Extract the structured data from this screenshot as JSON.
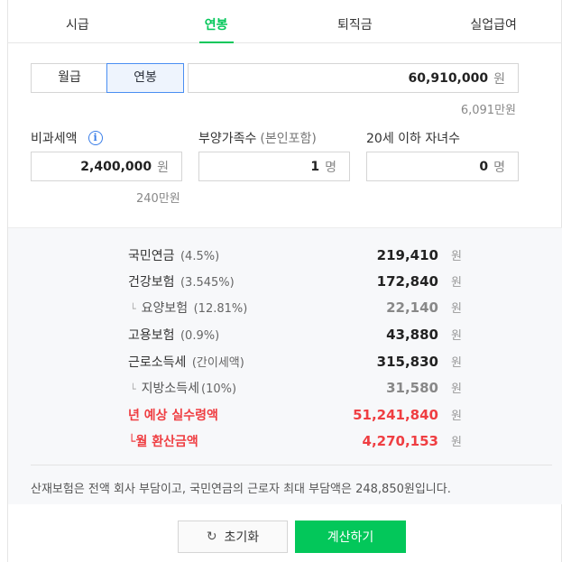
{
  "tabs": [
    {
      "label": "시급",
      "active": false
    },
    {
      "label": "연봉",
      "active": true
    },
    {
      "label": "퇴직금",
      "active": false
    },
    {
      "label": "실업급여",
      "active": false
    }
  ],
  "pay_type": {
    "monthly": "월급",
    "annual": "연봉",
    "selected": "연봉"
  },
  "salary": {
    "value": "60,910,000",
    "unit": "원",
    "sub": "6,091만원"
  },
  "nontax": {
    "label": "비과세액",
    "value": "2,400,000",
    "unit": "원",
    "sub": "240만원"
  },
  "dependents": {
    "label": "부양가족수",
    "label_note": "(본인포함)",
    "value": "1",
    "unit": "명"
  },
  "children": {
    "label": "20세 이하 자녀수",
    "value": "0",
    "unit": "명"
  },
  "results": {
    "won": "원",
    "national_pension": {
      "label": "국민연금",
      "pct": "(4.5%)",
      "value": "219,410"
    },
    "health": {
      "label": "건강보험",
      "pct": "(3.545%)",
      "value": "172,840"
    },
    "care": {
      "arrow": "└",
      "label": "요양보험",
      "pct": "(12.81%)",
      "value": "22,140"
    },
    "employment": {
      "label": "고용보험",
      "pct": "(0.9%)",
      "value": "43,880"
    },
    "income_tax": {
      "label": "근로소득세",
      "pct": "(간이세액)",
      "value": "315,830"
    },
    "local_tax": {
      "arrow": "└",
      "label": "지방소득세",
      "pct": "(10%)",
      "value": "31,580"
    },
    "annual_net": {
      "label": "년 예상 실수령액",
      "value": "51,241,840"
    },
    "monthly_net": {
      "arrow": "└",
      "label": "월 환산금액",
      "value": "4,270,153"
    }
  },
  "note": "산재보험은 전액 회사 부담이고, 국민연금의 근로자 최대 부담액은 248,850원입니다.",
  "buttons": {
    "reset": "초기화",
    "calc": "계산하기",
    "reset_icon": "↻"
  },
  "colors": {
    "accent": "#03c75a",
    "highlight": "#ef3e42",
    "info": "#3a7ee8"
  }
}
